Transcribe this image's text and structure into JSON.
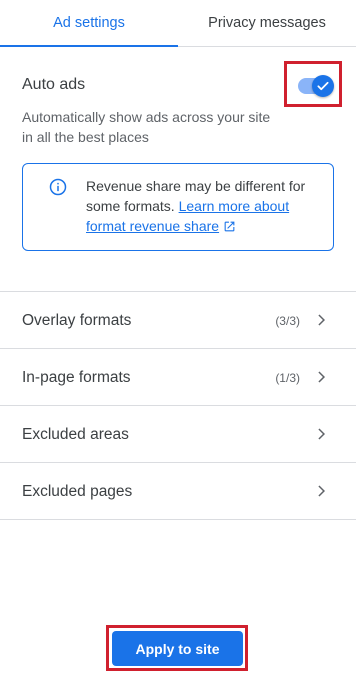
{
  "tabs": [
    {
      "label": "Ad settings",
      "active": true
    },
    {
      "label": "Privacy messages",
      "active": false
    }
  ],
  "auto_ads": {
    "title": "Auto ads",
    "description": "Automatically show ads across your site in all the best places",
    "toggle_on": true
  },
  "info": {
    "text": "Revenue share may be different for some formats.",
    "link_text": "Learn more about format revenue share",
    "icon": "info-icon",
    "link_icon": "open-in-new-icon"
  },
  "rows": [
    {
      "label": "Overlay formats",
      "count": "(3/3)"
    },
    {
      "label": "In-page formats",
      "count": "(1/3)"
    },
    {
      "label": "Excluded areas",
      "count": ""
    },
    {
      "label": "Excluded pages",
      "count": ""
    }
  ],
  "apply_button": {
    "label": "Apply to site"
  },
  "colors": {
    "accent": "#1a73e8",
    "highlight": "#d0202e",
    "divider": "#dadce0"
  }
}
